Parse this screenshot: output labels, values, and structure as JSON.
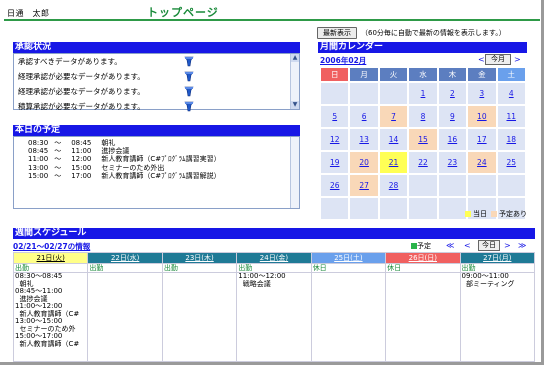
{
  "header": {
    "user_name": "日通　太郎",
    "page_title": "トップページ"
  },
  "refresh": {
    "button_label": "最新表示",
    "note": "（60分毎に自動で最新の情報を表示します。）"
  },
  "approval": {
    "title": "承認状況",
    "items": [
      {
        "text": "承認すべきデータがあります。"
      },
      {
        "text": "経理承認が必要なデータがあります。"
      },
      {
        "text": "経理承認が必要なデータがあります。"
      },
      {
        "text": "積算承認が必要なデータがあります。"
      }
    ]
  },
  "today": {
    "title": "本日の予定",
    "items": [
      {
        "start": "08:30",
        "end": "08:45",
        "title": "朝礼"
      },
      {
        "start": "08:45",
        "end": "11:00",
        "title": "進捗会議"
      },
      {
        "start": "11:00",
        "end": "12:00",
        "title": "新人教育講師（C#ﾌﾟﾛｸﾞﾗﾑ講習実習）"
      },
      {
        "start": "13:00",
        "end": "15:00",
        "title": "セミナーのため外出"
      },
      {
        "start": "15:00",
        "end": "17:00",
        "title": "新人教育講師（C#ﾌﾟﾛｸﾞﾗﾑ講習解説）"
      }
    ],
    "tilde": "～"
  },
  "calendar": {
    "title": "月間カレンダー",
    "month_label": "2006年02月",
    "prev": "<",
    "today_button": "今月",
    "next": ">",
    "weekdays": [
      "日",
      "月",
      "火",
      "水",
      "木",
      "金",
      "土"
    ],
    "weekday_colors": [
      "#f06060",
      "#5c7ec0",
      "#5c7ec0",
      "#5c7ec0",
      "#5c7ec0",
      "#5c7ec0",
      "#6aa0ec"
    ],
    "weeks": [
      [
        "",
        "",
        "",
        "1",
        "2",
        "3",
        "4"
      ],
      [
        "5",
        "6",
        "7",
        "8",
        "9",
        "10",
        "11"
      ],
      [
        "12",
        "13",
        "14",
        "15",
        "16",
        "17",
        "18"
      ],
      [
        "19",
        "20",
        "21",
        "22",
        "23",
        "24",
        "25"
      ],
      [
        "26",
        "27",
        "28",
        "",
        "",
        "",
        ""
      ],
      [
        "",
        "",
        "",
        "",
        "",
        "",
        ""
      ]
    ],
    "planned_days": [
      "7",
      "10",
      "15",
      "20",
      "24",
      "27"
    ],
    "today_day": "21",
    "legend_today": "当日",
    "legend_planned": "予定あり",
    "colors": {
      "today": "#ffff55",
      "planned": "#f9d8b8"
    }
  },
  "weekly": {
    "title": "週間スケジュール",
    "range_label": "02/21～02/27の情報",
    "legend": "予定",
    "nav_first": "≪",
    "nav_prev": "<",
    "today_button": "今日",
    "nav_next": ">",
    "nav_last": "≫",
    "days": [
      {
        "label": "21日(火)",
        "kind": "出勤",
        "bg": "#ffff88",
        "fg": "#000000",
        "entries": "08:30～08:45\n  朝礼\n08:45～11:00\n  進捗会議\n11:00～12:00\n  新人教育講師（C#\n13:00～15:00\n  セミナーのため外\n15:00～17:00\n  新人教育講師（C#"
      },
      {
        "label": "22日(水)",
        "kind": "出勤",
        "bg": "#1f7a96",
        "fg": "#ffffff",
        "entries": ""
      },
      {
        "label": "23日(木)",
        "kind": "出勤",
        "bg": "#1f7a96",
        "fg": "#ffffff",
        "entries": ""
      },
      {
        "label": "24日(金)",
        "kind": "出勤",
        "bg": "#1f7a96",
        "fg": "#ffffff",
        "entries": "11:00～12:00\n  戦略会議"
      },
      {
        "label": "25日(土)",
        "kind": "休日",
        "bg": "#6aa0ec",
        "fg": "#ffffff",
        "entries": ""
      },
      {
        "label": "26日(日)",
        "kind": "休日",
        "bg": "#f06060",
        "fg": "#ffffff",
        "entries": ""
      },
      {
        "label": "27日(月)",
        "kind": "出勤",
        "bg": "#1f7a96",
        "fg": "#ffffff",
        "entries": "09:00～11:00\n  部ミーティング"
      }
    ]
  }
}
